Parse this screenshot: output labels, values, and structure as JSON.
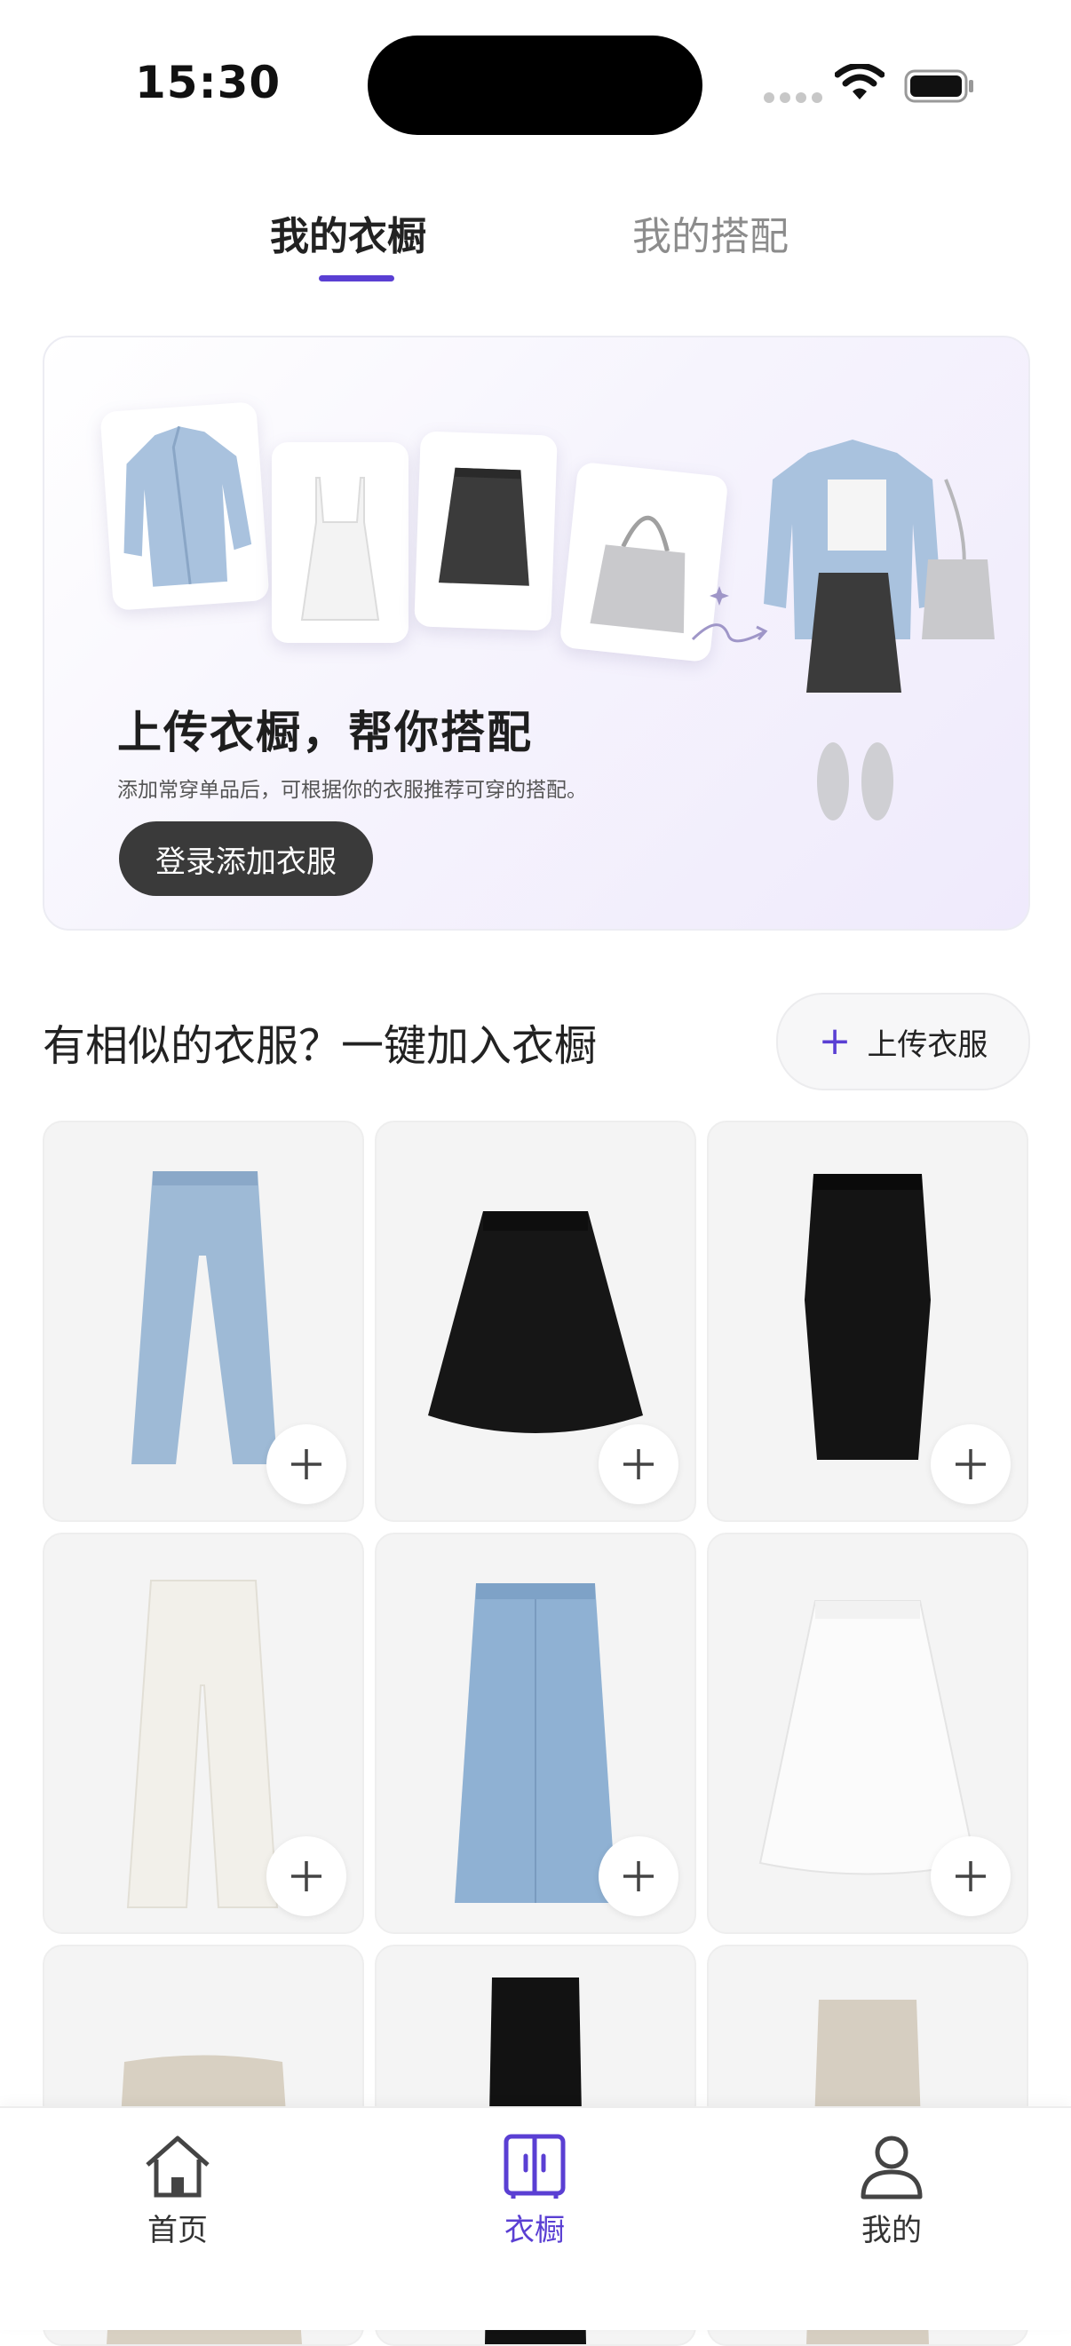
{
  "status_bar": {
    "time": "15:30"
  },
  "tabs": [
    {
      "label": "我的衣橱",
      "active": true
    },
    {
      "label": "我的搭配",
      "active": false
    }
  ],
  "banner": {
    "title": "上传衣橱，帮你搭配",
    "description": "添加常穿单品后，可根据你的衣服推荐可穿的搭配。",
    "button_label": "登录添加衣服"
  },
  "section": {
    "title": "有相似的衣服？一键加入衣橱",
    "upload_label": "上传衣服"
  },
  "items": [
    {
      "icon": "jeans-icon"
    },
    {
      "icon": "black-a-line-skirt-icon"
    },
    {
      "icon": "black-pencil-skirt-icon"
    },
    {
      "icon": "white-wide-pants-icon"
    },
    {
      "icon": "denim-long-skirt-icon"
    },
    {
      "icon": "white-pleated-skirt-icon"
    },
    {
      "icon": "beige-pants-icon"
    },
    {
      "icon": "black-leggings-icon"
    },
    {
      "icon": "beige-trousers-icon"
    }
  ],
  "bottom_nav": [
    {
      "label": "首页",
      "active": false
    },
    {
      "label": "衣橱",
      "active": true
    },
    {
      "label": "我的",
      "active": false
    }
  ],
  "colors": {
    "accent": "#5a3fd3",
    "button_dark": "#3a3a3a"
  }
}
